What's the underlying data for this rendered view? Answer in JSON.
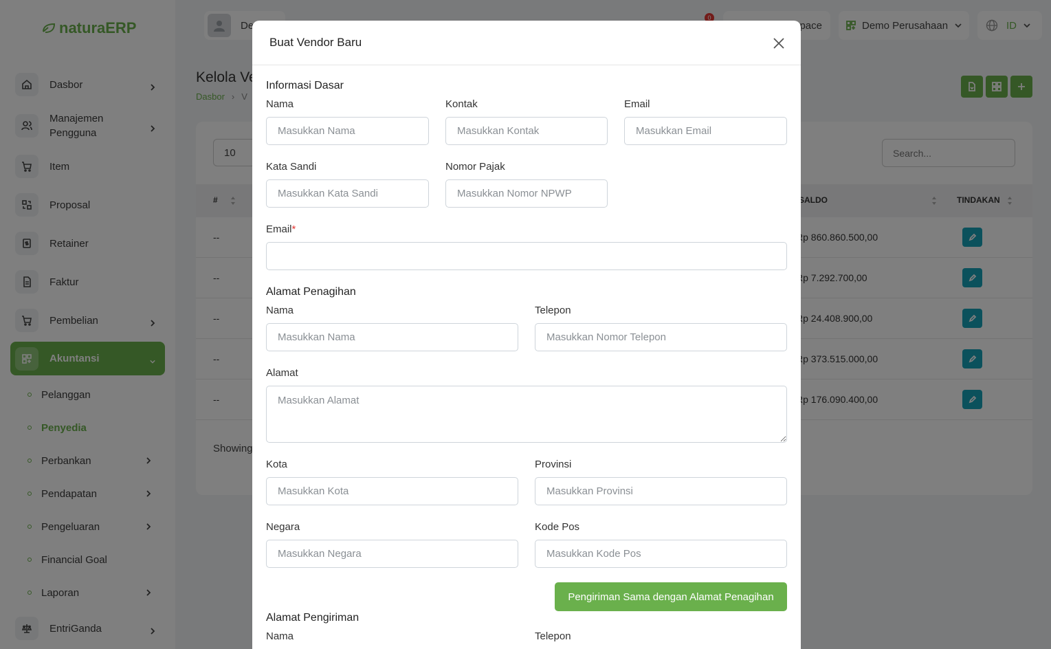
{
  "app": {
    "logo_prefix": "natura",
    "logo_suffix": "ERP"
  },
  "sidebar": {
    "items": [
      {
        "label": "Dasbor",
        "icon": "home-icon"
      },
      {
        "label": "Manajemen Pengguna",
        "icon": "users-icon"
      },
      {
        "label": "Item",
        "icon": "cart-icon"
      },
      {
        "label": "Proposal",
        "icon": "swap-icon"
      },
      {
        "label": "Retainer",
        "icon": "dollar-file-icon"
      },
      {
        "label": "Faktur",
        "icon": "file-icon"
      },
      {
        "label": "Pembelian",
        "icon": "cart-icon"
      },
      {
        "label": "Akuntansi",
        "icon": "grid-icon"
      },
      {
        "label": "EntriGanda",
        "icon": "scale-icon"
      }
    ],
    "sub_items": [
      {
        "label": "Pelanggan"
      },
      {
        "label": "Penyedia"
      },
      {
        "label": "Perbankan"
      },
      {
        "label": "Pendapatan"
      },
      {
        "label": "Pengeluaran"
      },
      {
        "label": "Financial Goal"
      },
      {
        "label": "Laporan"
      }
    ]
  },
  "topbar": {
    "user_name_partial": "Der",
    "notification_count": "0",
    "workspace_partial": "pace",
    "company": "Demo Perusahaan",
    "language": "ID"
  },
  "page": {
    "title_partial": "Kelola Ve",
    "breadcrumb": [
      "Dasbor",
      "V"
    ],
    "page_size": "10",
    "search_placeholder": "Search...",
    "columns": {
      "num": "#",
      "saldo": "SALDO",
      "actions": "TINDAKAN"
    },
    "rows": [
      {
        "num": "--",
        "saldo": "Rp 860.860.500,00"
      },
      {
        "num": "--",
        "saldo": "Rp 7.292.700,00"
      },
      {
        "num": "--",
        "saldo": "Rp 24.408.900,00"
      },
      {
        "num": "--",
        "saldo": "Rp 373.515.000,00"
      },
      {
        "num": "--",
        "saldo": "Rp 176.090.400,00"
      }
    ],
    "showing_partial": "Showing"
  },
  "modal": {
    "title": "Buat Vendor Baru",
    "basic": {
      "section": "Informasi Dasar",
      "name_label": "Nama",
      "name_placeholder": "Masukkan Nama",
      "contact_label": "Kontak",
      "contact_placeholder": "Masukkan Kontak",
      "email_label": "Email",
      "email_placeholder": "Masukkan Email",
      "password_label": "Kata Sandi",
      "password_placeholder": "Masukkan Kata Sandi",
      "tax_label": "Nomor Pajak",
      "tax_placeholder": "Masukkan Nomor NPWP",
      "email2_label": "Email",
      "email2_required": "*",
      "email2_value": ""
    },
    "billing": {
      "section": "Alamat Penagihan",
      "name_label": "Nama",
      "name_placeholder": "Masukkan Nama",
      "phone_label": "Telepon",
      "phone_placeholder": "Masukkan Nomor Telepon",
      "address_label": "Alamat",
      "address_placeholder": "Masukkan Alamat",
      "city_label": "Kota",
      "city_placeholder": "Masukkan Kota",
      "province_label": "Provinsi",
      "province_placeholder": "Masukkan Provinsi",
      "country_label": "Negara",
      "country_placeholder": "Masukkan Negara",
      "zip_label": "Kode Pos",
      "zip_placeholder": "Masukkan Kode Pos"
    },
    "copy_button": "Pengiriman Sama dengan Alamat Penagihan",
    "shipping": {
      "section": "Alamat Pengiriman",
      "name_label": "Nama",
      "phone_label": "Telepon"
    }
  },
  "colors": {
    "accent": "#6ab04c",
    "info": "#17a2b8",
    "danger": "#e53935"
  }
}
